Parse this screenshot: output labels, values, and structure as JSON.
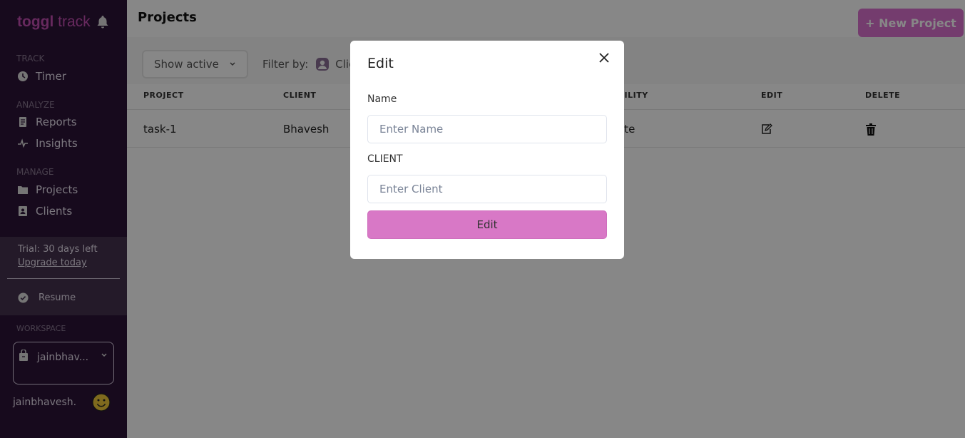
{
  "sidebar": {
    "logo": "toggl track",
    "logo_bold": "toggl",
    "logo_rest": "track",
    "sections": {
      "track": "TRACK",
      "analyze": "ANALYZE",
      "manage": "MANAGE",
      "workspace": "WORKSPACE"
    },
    "items": [
      {
        "label": "Timer",
        "icon": "clock-icon"
      },
      {
        "label": "Reports",
        "icon": "report-icon"
      },
      {
        "label": "Insights",
        "icon": "pulse-icon"
      },
      {
        "label": "Projects",
        "icon": "folder-icon"
      },
      {
        "label": "Clients",
        "icon": "contact-icon"
      }
    ],
    "trial": "Trial: 30 days left",
    "upgrade": "Upgrade today",
    "resume": "Resume",
    "workspace_name": "jainbhav...",
    "username": "jainbhavesh."
  },
  "header": {
    "title": "Projects",
    "new_project": "+ New Project"
  },
  "toolbar": {
    "show_active": "Show active",
    "filter_by": "Filter by:",
    "filter_client": "Client"
  },
  "table": {
    "columns": [
      "PROJECT",
      "CLIENT",
      "VISIBILITY",
      "EDIT",
      "DELETE"
    ],
    "rows": [
      {
        "project": "task-1",
        "client": "Bhavesh",
        "visibility": "Private"
      }
    ]
  },
  "modal": {
    "title": "Edit",
    "name_label": "Name",
    "name_placeholder": "Enter Name",
    "client_label": "CLIENT",
    "client_placeholder": "Enter Client",
    "submit": "Edit"
  },
  "colors": {
    "sidebar": "#2c1338",
    "accent": "#dc72d0",
    "edit_button": "#d878c6"
  }
}
